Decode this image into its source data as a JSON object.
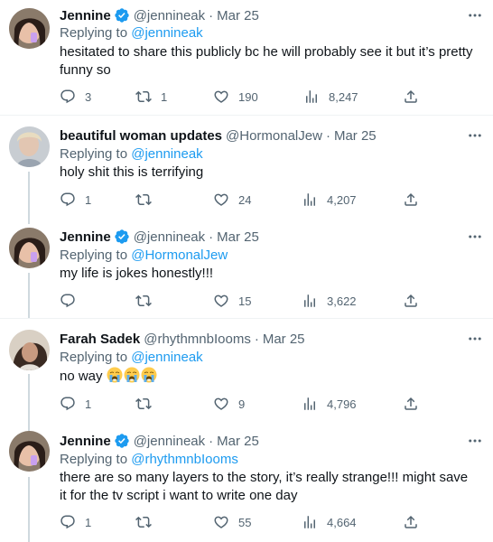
{
  "thread": [
    {
      "name": "Jennine",
      "verified": true,
      "handle": "@jennineak",
      "date": "Mar 25",
      "replying_label": "Replying to",
      "replying_to": "@jennineak",
      "text": "hesitated to share this publicly bc he will probably see it but it’s pretty funny so",
      "replies": "3",
      "retweets": "1",
      "likes": "190",
      "views": "8,247"
    },
    {
      "name": "beautiful woman updates",
      "verified": false,
      "handle": "@HormonalJew",
      "date": "Mar 25",
      "replying_label": "Replying to",
      "replying_to": "@jennineak",
      "text": "holy shit this is terrifying",
      "replies": "1",
      "retweets": "",
      "likes": "24",
      "views": "4,207"
    },
    {
      "name": "Jennine",
      "verified": true,
      "handle": "@jennineak",
      "date": "Mar 25",
      "replying_label": "Replying to",
      "replying_to": "@HormonalJew",
      "text": "my life is jokes honestly!!!",
      "replies": "",
      "retweets": "",
      "likes": "15",
      "views": "3,622"
    },
    {
      "name": "Farah Sadek",
      "verified": false,
      "handle": "@rhythmnbIooms",
      "date": "Mar 25",
      "replying_label": "Replying to",
      "replying_to": "@jennineak",
      "text": "no way",
      "emoji": [
        "loudly-crying-face",
        "loudly-crying-face",
        "loudly-crying-face"
      ],
      "replies": "1",
      "retweets": "",
      "likes": "9",
      "views": "4,796"
    },
    {
      "name": "Jennine",
      "verified": true,
      "handle": "@jennineak",
      "date": "Mar 25",
      "replying_label": "Replying to",
      "replying_to": "@rhythmnbIooms",
      "text": "there are so many layers to the story, it’s really strange!!! might save it for the tv script i want to write one day",
      "replies": "1",
      "retweets": "",
      "likes": "55",
      "views": "4,664"
    }
  ],
  "colors": {
    "text": "#0f1419",
    "secondary": "#536471",
    "link": "#1d9bf0",
    "verified": "#1d9bf0",
    "divider": "#eff3f4",
    "thread_line": "#cfd9de"
  },
  "icons": [
    "more-icon",
    "verified-badge-icon",
    "reply-icon",
    "retweet-icon",
    "like-icon",
    "views-icon",
    "share-icon"
  ]
}
